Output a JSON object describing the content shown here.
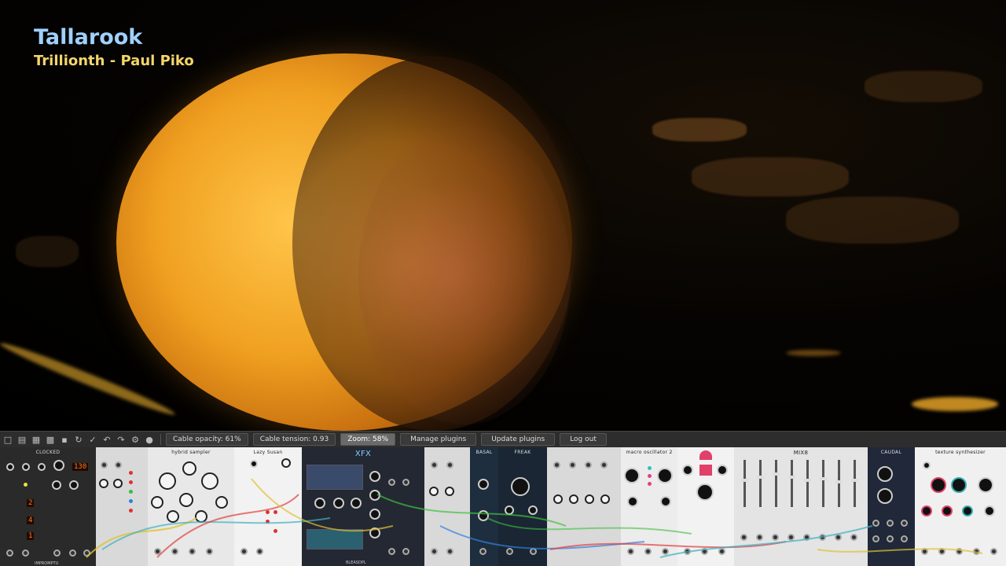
{
  "overlay": {
    "title": "Tallarook",
    "subtitle": "Trillionth - Paul Piko"
  },
  "toolbar": {
    "icons": [
      "new-file-icon",
      "open-folder-icon",
      "open-recent-icon",
      "save-icon",
      "save-as-icon",
      "revert-icon",
      "disconnect-icon",
      "undo-icon",
      "redo-icon",
      "engine-icon",
      "lock-icon"
    ],
    "cable_opacity": "Cable opacity: 61%",
    "cable_tension": "Cable tension: 0.93",
    "zoom": "Zoom: 58%",
    "manage_plugins": "Manage plugins",
    "update_plugins": "Update plugins",
    "log_out": "Log out"
  },
  "modules": [
    {
      "id": "clocked",
      "title": "CLOCKED",
      "footer": "IMPROMPTU",
      "display_bpm": "130",
      "display_ratio1": "2",
      "display_ratio2": "4",
      "display_ratio3": "1"
    },
    {
      "id": "seq",
      "title": ""
    },
    {
      "id": "hybrid",
      "title": "hybrid sampler"
    },
    {
      "id": "lazy",
      "title": "Lazy Susan"
    },
    {
      "id": "xfx",
      "title": "XFX",
      "footer": "BLEASDPL"
    },
    {
      "id": "basal",
      "title": "BASAL"
    },
    {
      "id": "freak",
      "title": "FREAK"
    },
    {
      "id": "macro",
      "title": "macro oscillator 2"
    },
    {
      "id": "mixer",
      "title": "MIX8"
    },
    {
      "id": "caudal",
      "title": "CAUDAL"
    },
    {
      "id": "texture",
      "title": "texture synthesizer"
    }
  ],
  "colors": {
    "accent_title": "#9fd0ff",
    "accent_subtitle": "#f3d66a",
    "sphere": "#f0a020"
  }
}
